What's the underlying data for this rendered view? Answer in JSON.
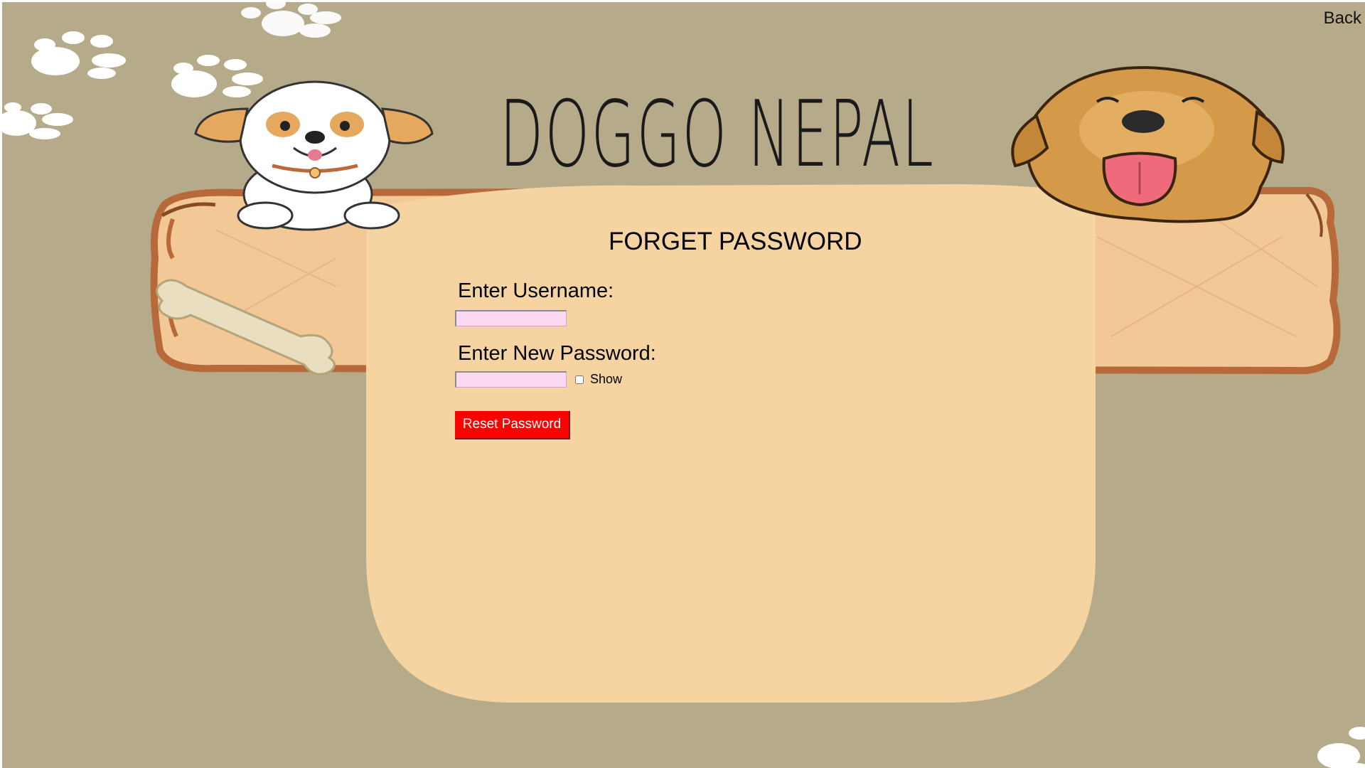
{
  "nav": {
    "back_label": "Back"
  },
  "brand": {
    "title": "DOGGO NEPAL"
  },
  "form": {
    "title": "FORGET PASSWORD",
    "username_label": "Enter Username:",
    "username_value": "",
    "new_password_label": "Enter New Password:",
    "new_password_value": "",
    "show_label": "Show",
    "show_checked": false,
    "submit_label": "Reset Password"
  },
  "colors": {
    "background": "#b5ab8a",
    "card": "#f6d4a2",
    "plank": "#f2c896",
    "plank_edge": "#b8693a",
    "input_fill": "#fbd9f3",
    "button": "#ff0000",
    "paw": "#ffffff"
  },
  "illustrations": {
    "left_dog": "puppy-icon",
    "right_dog": "golden-retriever-icon",
    "bone": "bone-icon",
    "paws": "paw-print-icon"
  }
}
